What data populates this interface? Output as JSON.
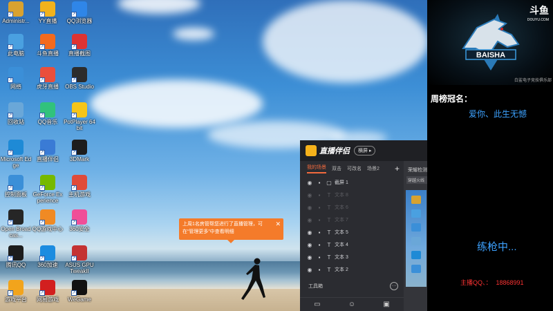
{
  "desktop": {
    "icons": [
      {
        "label": "Administr...",
        "color": "#d8a230",
        "glyph": "folder-icon"
      },
      {
        "label": "YY直播",
        "color": "#f2b21c",
        "glyph": "yy-icon"
      },
      {
        "label": "QQ浏览器",
        "color": "#2f86e8",
        "glyph": "browser-icon"
      },
      {
        "label": "此电脑",
        "color": "#4aa0e0",
        "glyph": "computer-icon"
      },
      {
        "label": "斗鱼直播",
        "color": "#f36a1d",
        "glyph": "douyu-icon"
      },
      {
        "label": "直播截图",
        "color": "#d33",
        "glyph": "screenshot-icon"
      },
      {
        "label": "网络",
        "color": "#3b8fd8",
        "glyph": "network-icon"
      },
      {
        "label": "虎牙直播",
        "color": "#e94f3c",
        "glyph": "huya-icon"
      },
      {
        "label": "OBS Studio",
        "color": "#2c2c2c",
        "glyph": "obs-icon"
      },
      {
        "label": "回收站",
        "color": "#6aa7d8",
        "glyph": "recycle-bin-icon"
      },
      {
        "label": "QQ音乐",
        "color": "#31c27c",
        "glyph": "music-icon"
      },
      {
        "label": "PotPlayer 64 bit",
        "color": "#f5c518",
        "glyph": "player-icon"
      },
      {
        "label": "Microsoft Edge",
        "color": "#1e8ad6",
        "glyph": "edge-icon"
      },
      {
        "label": "直播伴侣",
        "color": "#3a7bd5",
        "glyph": "companion-icon"
      },
      {
        "label": "3DMark",
        "color": "#1d1d1d",
        "glyph": "3dmark-icon"
      },
      {
        "label": "控制面板",
        "color": "#3b8fd8",
        "glyph": "control-panel-icon"
      },
      {
        "label": "GeForce Experience",
        "color": "#76b900",
        "glyph": "geforce-icon"
      },
      {
        "label": "主机游戏",
        "color": "#e04b3a",
        "glyph": "game-icon"
      },
      {
        "label": "Open Broadcas...",
        "color": "#262626",
        "glyph": "obs-icon"
      },
      {
        "label": "QQ游戏中心",
        "color": "#f08a24",
        "glyph": "qq-game-icon"
      },
      {
        "label": "360安全",
        "color": "#f04e98",
        "glyph": "security-icon"
      },
      {
        "label": "腾讯QQ",
        "color": "#1c1c1c",
        "glyph": "qq-icon"
      },
      {
        "label": "360加速",
        "color": "#1c8ce0",
        "glyph": "speed-icon"
      },
      {
        "label": "ASUS GPU TweakII",
        "color": "#c43232",
        "glyph": "asus-icon"
      },
      {
        "label": "游戏平台",
        "color": "#f2a41c",
        "glyph": "platform-icon"
      },
      {
        "label": "网易游戏",
        "color": "#d21f1f",
        "glyph": "netease-icon"
      },
      {
        "label": "WeGame",
        "color": "#111",
        "glyph": "wegame-icon"
      }
    ]
  },
  "toast": {
    "text": "上周1名房管帮您进行了直播管理，可在“管理更多”中查看明细",
    "close": "✕"
  },
  "companion": {
    "app_name": "直播伴侣",
    "mode_label": "横屏 ▸",
    "tabs": [
      "我的场景",
      "双击",
      "可改名",
      "场景2"
    ],
    "active_tab": 0,
    "plus": "+",
    "right_header": "荣耀检测",
    "right_chip": "穿越火线",
    "layers": [
      {
        "name": "截屏 1",
        "dim": false,
        "type": "▢"
      },
      {
        "name": "文本 8",
        "dim": true,
        "type": "T"
      },
      {
        "name": "文本 6",
        "dim": true,
        "type": "T"
      },
      {
        "name": "文本 7",
        "dim": true,
        "type": "T"
      },
      {
        "name": "文本 5",
        "dim": false,
        "type": "T"
      },
      {
        "name": "文本 4",
        "dim": false,
        "type": "T"
      },
      {
        "name": "文本 3",
        "dim": false,
        "type": "T"
      },
      {
        "name": "文本 2",
        "dim": false,
        "type": "T"
      }
    ],
    "toolbox": "工具箱",
    "more": "···"
  },
  "sidebar": {
    "douyu": "斗鱼",
    "douyu_sub": "DOUYU.COM",
    "cam_caption": "白鲨电子竞技俱乐部",
    "champ_title": "周榜冠名：",
    "champ_name": "爱你、此生无憾",
    "status": "练枪中...",
    "qq_label": "主播QQ、：",
    "qq_number": "18868991"
  }
}
